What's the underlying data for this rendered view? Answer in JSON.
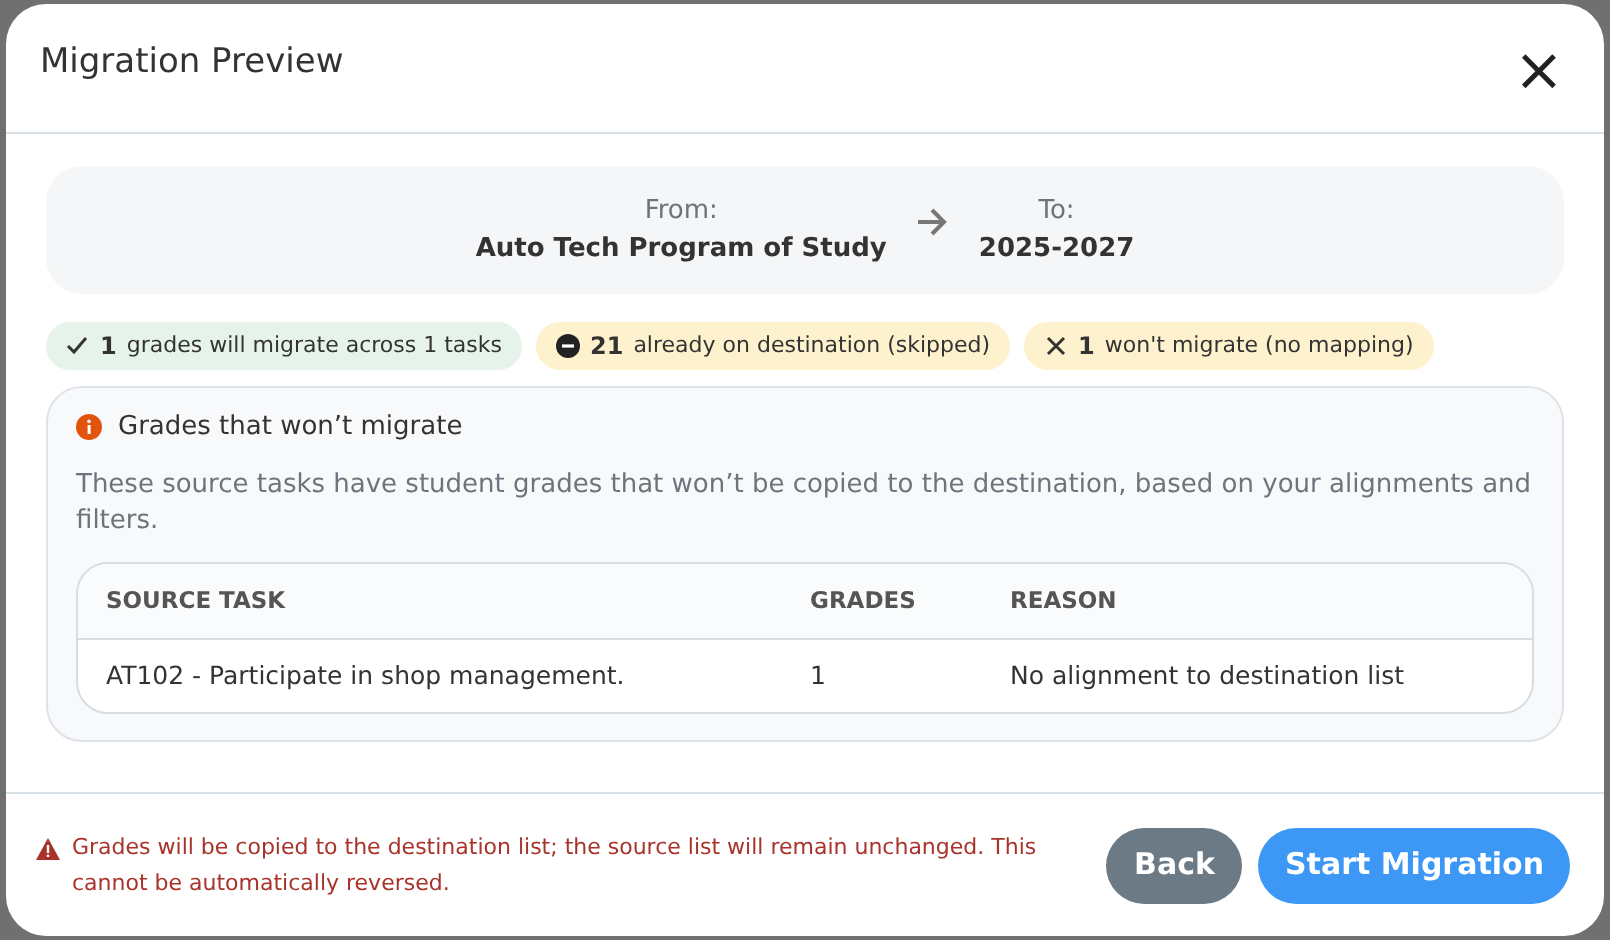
{
  "dialog": {
    "title": "Migration Preview",
    "close": "×"
  },
  "route": {
    "from_label": "From:",
    "from_value": "Auto Tech Program of Study",
    "to_label": "To:",
    "to_value": "2025-2027"
  },
  "chips": [
    {
      "kind": "success",
      "count": "1",
      "label": "grades will migrate across 1 tasks"
    },
    {
      "kind": "skipped",
      "count": "21",
      "label": "already on destination (skipped)"
    },
    {
      "kind": "failed",
      "count": "1",
      "label": "won't migrate (no mapping)"
    }
  ],
  "panel": {
    "title": "Grades that won’t migrate",
    "description": "These source tasks have student grades that won’t be copied to the destination, based on your alignments and filters.",
    "table": {
      "columns": [
        "SOURCE TASK",
        "GRADES",
        "REASON"
      ],
      "rows": [
        [
          "AT102 - Participate in shop management.",
          "1",
          "No alignment to destination list"
        ]
      ]
    }
  },
  "footer": {
    "warning": "Grades will be copied to the destination list; the source list will remain unchanged. This cannot be automatically reversed.",
    "buttons": [
      {
        "kind": "secondary",
        "label": "Back"
      },
      {
        "kind": "primary",
        "label": "Start Migration"
      }
    ]
  }
}
